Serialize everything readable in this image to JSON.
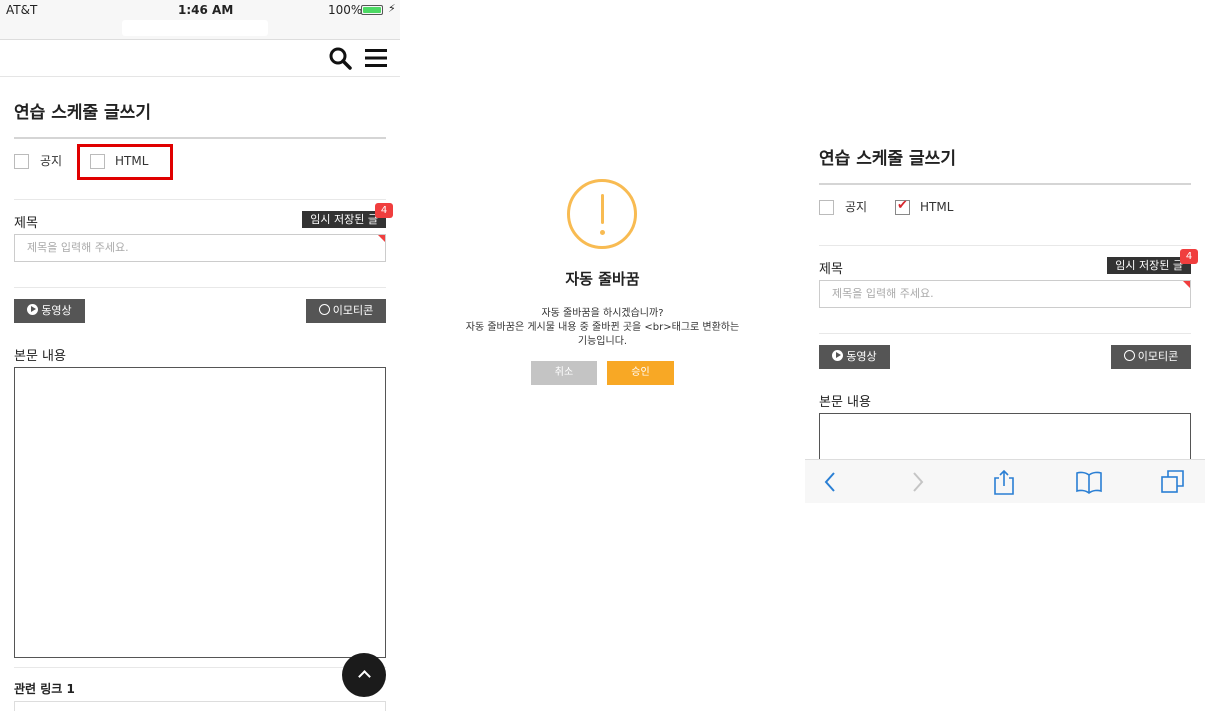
{
  "status_bar": {
    "carrier": "AT&T",
    "time": "1:46 AM",
    "battery": "100%"
  },
  "form": {
    "title": "연습 스케줄 글쓰기",
    "notice_label": "공지",
    "html_label": "HTML",
    "subject_label": "제목",
    "temp_save_label": "임시 저장된 글",
    "temp_save_count": "4",
    "subject_placeholder": "제목을 입력해 주세요.",
    "video_button": "동영상",
    "emoticon_button": "이모티콘",
    "body_label": "본문 내용",
    "related_link_label": "관련 링크 1"
  },
  "left_state": {
    "html_checked": false
  },
  "right_state": {
    "html_checked": true
  },
  "modal": {
    "title": "자동 줄바꿈",
    "message_line1": "자동 줄바꿈을 하시겠습니까?",
    "message_line2": "자동 줄바꿈은 게시물 내용 중 줄바뀐 곳을 <br>태그로 변환하는",
    "message_line3": "기능입니다.",
    "cancel_label": "취소",
    "ok_label": "승인"
  },
  "colors": {
    "warning": "#f8bb52",
    "ok_button": "#f8a825",
    "highlight": "#e00000",
    "badge": "#f03e3e"
  }
}
